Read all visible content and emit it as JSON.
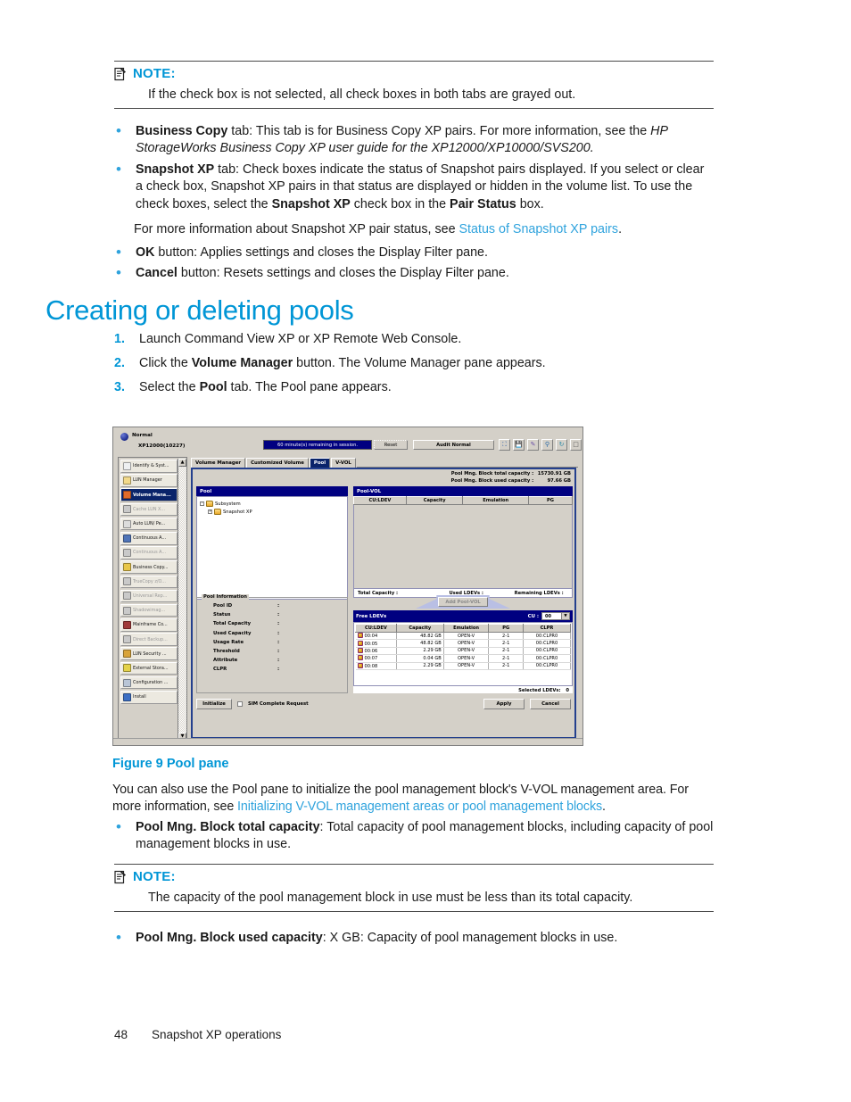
{
  "note1": {
    "icon": "note-icon",
    "title": "NOTE:",
    "body": "If the check box is not selected, all check boxes in both tabs are grayed out."
  },
  "bullets_top": [
    {
      "lead": "Business Copy",
      "rest": " tab:  This tab is for Business Copy XP pairs.  For more information, see the ",
      "italic": "HP StorageWorks Business Copy XP user guide for the XP12000/XP10000/SVS200."
    },
    {
      "lead": "Snapshot XP",
      "rest": " tab:  Check boxes indicate the status of Snapshot pairs displayed.  If you select or clear a check box, Snapshot XP pairs in that status are displayed or hidden in the volume list. To use the check boxes, select the ",
      "bold2": "Snapshot XP",
      "rest2": " check box in the ",
      "bold3": "Pair Status",
      "rest3": " box."
    }
  ],
  "sub_para": {
    "text": "For more information about Snapshot XP pair status, see ",
    "link": "Status of Snapshot XP pairs",
    "tail": "."
  },
  "bullets_ok": [
    {
      "lead": "OK",
      "rest": " button:  Applies settings and closes the Display Filter pane."
    },
    {
      "lead": "Cancel",
      "rest": " button:  Resets settings and closes the Display Filter pane."
    }
  ],
  "heading": "Creating or deleting pools",
  "steps": [
    {
      "num": "1.",
      "pre": "Launch Command View XP or XP Remote Web Console.",
      "bold": "",
      "post": ""
    },
    {
      "num": "2.",
      "pre": "Click the ",
      "bold": "Volume Manager",
      "post": " button.  The Volume Manager pane appears."
    },
    {
      "num": "3.",
      "pre": "Select the ",
      "bold": "Pool",
      "post": " tab.  The Pool pane appears."
    }
  ],
  "figure": {
    "caption": "Figure 9 Pool pane",
    "app": {
      "status_label": "Normal",
      "subsystem": "XP12000(10227)",
      "session_text": "60 minute(s) remaining in session.",
      "reset_button": "Reset",
      "audit_button": "Audit Normal",
      "tool_icons": [
        "refresh-icon",
        "save-icon",
        "key-icon",
        "preview-icon",
        "undo-icon",
        "exit-icon"
      ],
      "sidebar": [
        {
          "label": "Identify & Syst...",
          "state": "normal",
          "icon": "identity-icon",
          "color": "#eef0f2"
        },
        {
          "label": "LUN Manager",
          "state": "normal",
          "icon": "lun-manager-icon",
          "color": "#f2d98a"
        },
        {
          "label": "Volume Mana...",
          "state": "selected",
          "icon": "volume-manager-icon",
          "color": "#e06a2a"
        },
        {
          "label": "Cache LUN X...",
          "state": "disabled",
          "icon": "cache-lun-icon",
          "color": "#c9c9c9"
        },
        {
          "label": "Auto LUN/ Pe...",
          "state": "normal",
          "icon": "auto-lun-icon",
          "color": "#dcdcdc"
        },
        {
          "label": "Continuous A...",
          "state": "normal",
          "icon": "continuous-access-icon",
          "color": "#4f74b8"
        },
        {
          "label": "Continuous A...",
          "state": "disabled",
          "icon": "continuous-access-2-icon",
          "color": "#c9c9c9"
        },
        {
          "label": "Business Copy...",
          "state": "normal",
          "icon": "business-copy-icon",
          "color": "#e8c64a"
        },
        {
          "label": "TrueCopy z/O...",
          "state": "disabled",
          "icon": "truecopy-icon",
          "color": "#c9c9c9"
        },
        {
          "label": "Universal Rep...",
          "state": "disabled",
          "icon": "universal-replicator-icon",
          "color": "#c9c9c9"
        },
        {
          "label": "Shadowimag...",
          "state": "disabled",
          "icon": "shadowimage-icon",
          "color": "#c9c9c9"
        },
        {
          "label": "Mainframe Co...",
          "state": "normal",
          "icon": "mainframe-icon",
          "color": "#a03a3a"
        },
        {
          "label": "Direct Backup...",
          "state": "disabled",
          "icon": "direct-backup-icon",
          "color": "#c9c9c9"
        },
        {
          "label": "LUN Security ...",
          "state": "normal",
          "icon": "lun-security-icon",
          "color": "#d8a33a"
        },
        {
          "label": "External Stora...",
          "state": "normal",
          "icon": "external-storage-icon",
          "color": "#e4d24a"
        },
        {
          "label": "Configuration ...",
          "state": "normal",
          "icon": "configuration-icon",
          "color": "#b9c5d6"
        },
        {
          "label": "Install",
          "state": "normal",
          "icon": "install-icon",
          "color": "#3d6fc4"
        }
      ],
      "tabs": [
        {
          "label": "Volume Manager",
          "active": false
        },
        {
          "label": "Customized Volume",
          "active": false
        },
        {
          "label": "Pool",
          "active": true
        },
        {
          "label": "V-VOL",
          "active": false
        }
      ],
      "capacity_header": [
        {
          "label": "Pool Mng. Block total capacity  :",
          "value": "15730.91 GB"
        },
        {
          "label": "Pool Mng. Block used capacity  :",
          "value": "97.66 GB"
        }
      ],
      "pool_panel": {
        "title": "Pool",
        "tree": [
          {
            "label": "Subsystem",
            "expander": "-",
            "level": 0
          },
          {
            "label": "Snapshot XP",
            "expander": "+",
            "level": 1
          }
        ]
      },
      "pool_information": {
        "legend": "Pool Information",
        "rows": [
          {
            "key": "Pool ID",
            "value": ""
          },
          {
            "key": "Status",
            "value": ""
          },
          {
            "key": "Total Capacity",
            "value": ""
          },
          {
            "key": "Used Capacity",
            "value": ""
          },
          {
            "key": "Usage Rate",
            "value": ""
          },
          {
            "key": "Threshold",
            "value": ""
          },
          {
            "key": "Attribute",
            "value": ""
          },
          {
            "key": "CLPR",
            "value": ""
          }
        ],
        "initialize_button": "Initialize",
        "sim_checkbox": "SIM Complete Request"
      },
      "poolvol_panel": {
        "title": "Pool-VOL",
        "columns": [
          "CU:LDEV",
          "Capacity",
          "Emulation",
          "PG"
        ],
        "rows": [],
        "footer": [
          "Total Capacity :",
          "Used LDEVs :",
          "Remaining LDEVs :"
        ],
        "add_button": "Add Pool-VOL"
      },
      "free_ldevs": {
        "title": "Free LDEVs",
        "cu_label": "CU :",
        "cu_value": "00",
        "columns": [
          "CU:LDEV",
          "Capacity",
          "Emulation",
          "PG",
          "CLPR"
        ],
        "rows": [
          {
            "ldev": "00:04",
            "capacity": "48.82 GB",
            "emulation": "OPEN-V",
            "pg": "2-1",
            "clpr": "00:CLPR0"
          },
          {
            "ldev": "00:05",
            "capacity": "48.82 GB",
            "emulation": "OPEN-V",
            "pg": "2-1",
            "clpr": "00:CLPR0"
          },
          {
            "ldev": "00:06",
            "capacity": "2.29 GB",
            "emulation": "OPEN-V",
            "pg": "2-1",
            "clpr": "00:CLPR0"
          },
          {
            "ldev": "00:07",
            "capacity": "0.04 GB",
            "emulation": "OPEN-V",
            "pg": "2-1",
            "clpr": "00:CLPR0"
          },
          {
            "ldev": "00:08",
            "capacity": "2.29 GB",
            "emulation": "OPEN-V",
            "pg": "2-1",
            "clpr": "00:CLPR0"
          }
        ],
        "selected_label": "Selected LDEVs:",
        "selected_count": "0"
      },
      "apply_button": "Apply",
      "cancel_button": "Cancel"
    }
  },
  "after_figure": {
    "para": "You can also use the Pool pane to initialize the pool management block's V-VOL management area. For more information, see ",
    "link": "Initializing V-VOL management areas or pool management blocks",
    "tail": ".",
    "bullet": {
      "lead": "Pool Mng. Block total capacity",
      "rest": ": Total capacity of pool management blocks, including capacity of pool management blocks in use."
    }
  },
  "note2": {
    "icon": "note-icon",
    "title": "NOTE:",
    "body": "The capacity of the pool management block in use must be less than its total capacity."
  },
  "last_bullet": {
    "lead": "Pool Mng. Block used capacity",
    "rest": ": X GB: Capacity of pool management blocks in use."
  },
  "footer": {
    "page_number": "48",
    "chapter": "Snapshot XP operations"
  }
}
